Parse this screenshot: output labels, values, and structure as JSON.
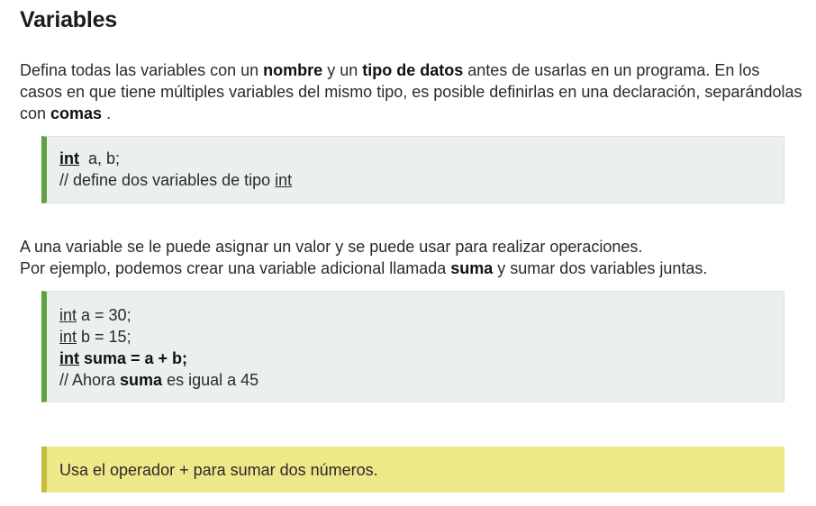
{
  "title": "Variables",
  "paragraph1": {
    "t1": "Defina todas las variables con un ",
    "b1": "nombre",
    "t2": " y un ",
    "b2": "tipo de datos",
    "t3": " antes de usarlas en un programa. En los casos en que tiene múltiples variables del mismo tipo, es posible definirlas en una declaración, separándolas con ",
    "b3": "comas",
    "t4": " ."
  },
  "code_block1": {
    "line1_keyword": "int",
    "line1_rest": "  a, b;",
    "line2_text": "// define dos variables de tipo ",
    "line2_keyword": "int"
  },
  "paragraph2": {
    "line1": "A una variable se le puede asignar un valor y se puede usar para realizar operaciones.",
    "t1": "Por ejemplo, podemos crear una variable adicional llamada ",
    "b1": "suma",
    "t2": " y sumar dos variables juntas."
  },
  "code_block2": {
    "keyword": "int",
    "line1_rest": " a = 30;",
    "line2_rest": " b = 15;",
    "line3_rest": " suma = a + b;",
    "line4_text": "// Ahora ",
    "line4_bold": "suma",
    "line4_rest": " es igual a 45"
  },
  "note": {
    "text": "Usa el operador + para sumar dos números."
  },
  "colors": {
    "code_accent": "#5fa142",
    "code_background": "#eceff0",
    "note_accent": "#c7bd3d",
    "note_background": "#efe889"
  }
}
